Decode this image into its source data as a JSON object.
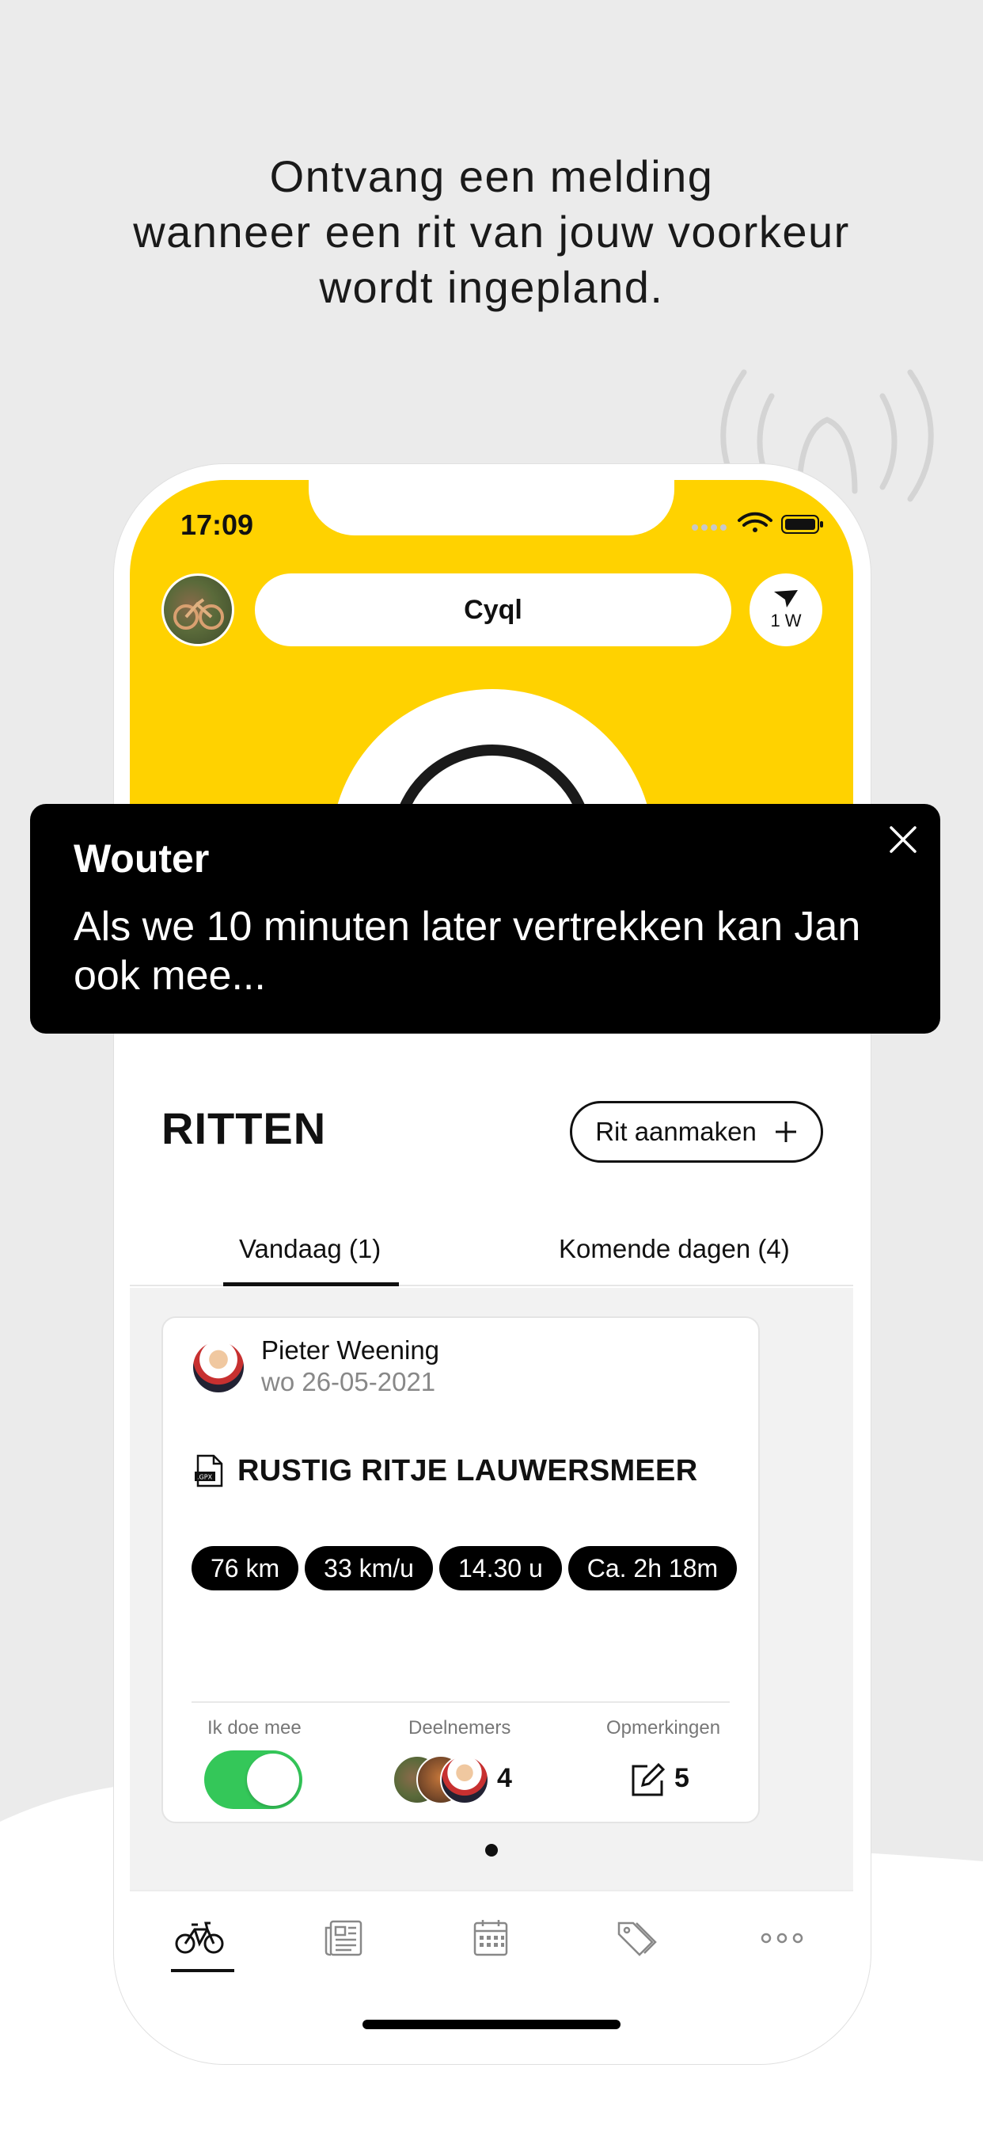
{
  "headline": {
    "line1": "Ontvang een melding",
    "line2": "wanneer een rit van jouw voorkeur",
    "line3": "wordt ingepland."
  },
  "status_bar": {
    "time": "17:09"
  },
  "header": {
    "app_name": "Cyql",
    "wind_label": "1 W"
  },
  "notification": {
    "sender": "Wouter",
    "message": "Als we 10 minuten later vertrekken kan Jan ook mee..."
  },
  "section": {
    "title": "RITTEN",
    "new_ride_label": "Rit aanmaken",
    "tabs": [
      {
        "label": "Vandaag  (1)",
        "active": true
      },
      {
        "label": "Komende dagen (4)",
        "active": false
      }
    ]
  },
  "ride_card": {
    "author": "Pieter  Weening",
    "date": "wo 26-05-2021",
    "title": "RUSTIG RITJE LAUWERSMEER",
    "chips": [
      "76 km",
      "33 km/u",
      "14.30 u",
      "Ca. 2h 18m"
    ],
    "join_label": "Ik doe mee",
    "join_on": true,
    "participants_label": "Deelnemers",
    "participants_count": "4",
    "comments_label": "Opmerkingen",
    "comments_count": "5"
  },
  "tabbar": {
    "items": [
      "bike-icon",
      "news-icon",
      "calendar-icon",
      "tag-icon",
      "more-icon"
    ],
    "active": "bike-icon"
  },
  "colors": {
    "brand_yellow": "#ffd200",
    "toggle_on": "#34c759",
    "background": "#ebebeb"
  }
}
